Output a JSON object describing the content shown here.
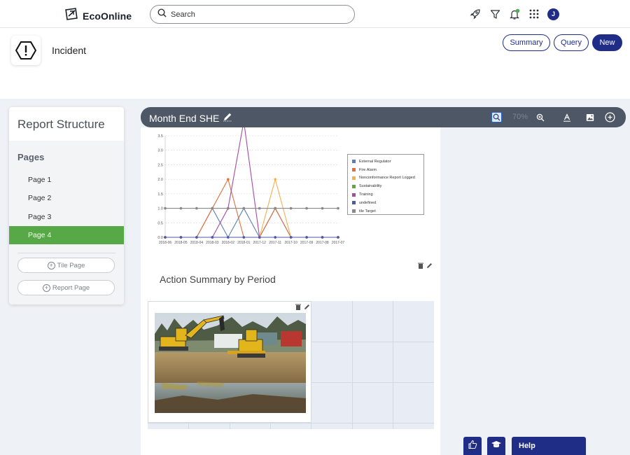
{
  "topbar": {
    "brand": "EcoOnline",
    "search_placeholder": "Search",
    "user_initial": "J",
    "icons": [
      "rocket-icon",
      "filter-icon",
      "bell-icon",
      "apps-grid-icon"
    ]
  },
  "header": {
    "module_title": "Incident",
    "buttons": {
      "summary": "Summary",
      "query": "Query",
      "new": "New"
    }
  },
  "sidebar": {
    "title": "Report Structure",
    "pages_label": "Pages",
    "items": [
      {
        "label": "Page 1",
        "active": false
      },
      {
        "label": "Page 2",
        "active": false
      },
      {
        "label": "Page 3",
        "active": false
      },
      {
        "label": "Page 4",
        "active": true
      }
    ],
    "tile_page_label": "Tile Page",
    "report_page_label": "Report Page"
  },
  "report": {
    "title": "Month End SHE",
    "zoom": "70%",
    "section_title": "Action Summary by Period"
  },
  "chart_data": {
    "type": "line",
    "categories": [
      "2018-06",
      "2018-05",
      "2018-04",
      "2018-03",
      "2018-02",
      "2018-01",
      "2017-12",
      "2017-11",
      "2017-10",
      "2017-09",
      "2017-08",
      "2017-07"
    ],
    "yticks": [
      "0.0",
      "0.5",
      "1.0",
      "1.5",
      "2.0",
      "2.5",
      "3.0",
      "3.5"
    ],
    "ylim": [
      0,
      3.5
    ],
    "series": [
      {
        "name": "External Regulator",
        "color": "#5b7fb7",
        "values": [
          0,
          0,
          0,
          1,
          0,
          1,
          0,
          1,
          0,
          0,
          0,
          0
        ]
      },
      {
        "name": "Fire Alarm",
        "color": "#e0703a",
        "values": [
          0,
          0,
          0,
          1,
          2,
          0,
          0,
          1,
          0,
          0,
          0,
          0
        ]
      },
      {
        "name": "Nonconformance Report Logged",
        "color": "#f2b04e",
        "values": [
          0,
          0,
          0,
          0,
          0,
          0,
          0,
          2,
          0,
          0,
          0,
          0
        ]
      },
      {
        "name": "Sustainability",
        "color": "#5aa844",
        "values": [
          0,
          0,
          0,
          0,
          0,
          0,
          0,
          0,
          0,
          0,
          0,
          0
        ]
      },
      {
        "name": "Training",
        "color": "#a54aa5",
        "values": [
          0,
          0,
          0,
          0,
          1,
          4,
          0,
          0,
          0,
          0,
          0,
          0
        ]
      },
      {
        "name": "undefined",
        "color": "#4b5ba6",
        "values": [
          0,
          0,
          0,
          0,
          0,
          0,
          0,
          0,
          0,
          0,
          0,
          0
        ]
      },
      {
        "name": "tile Target",
        "color": "#888888",
        "values": [
          1,
          1,
          1,
          1,
          1,
          1,
          1,
          1,
          1,
          1,
          1,
          1
        ]
      }
    ]
  },
  "footer": {
    "help_label": "Help",
    "icons": [
      "thumbs-up-icon",
      "graduation-cap-icon"
    ]
  }
}
